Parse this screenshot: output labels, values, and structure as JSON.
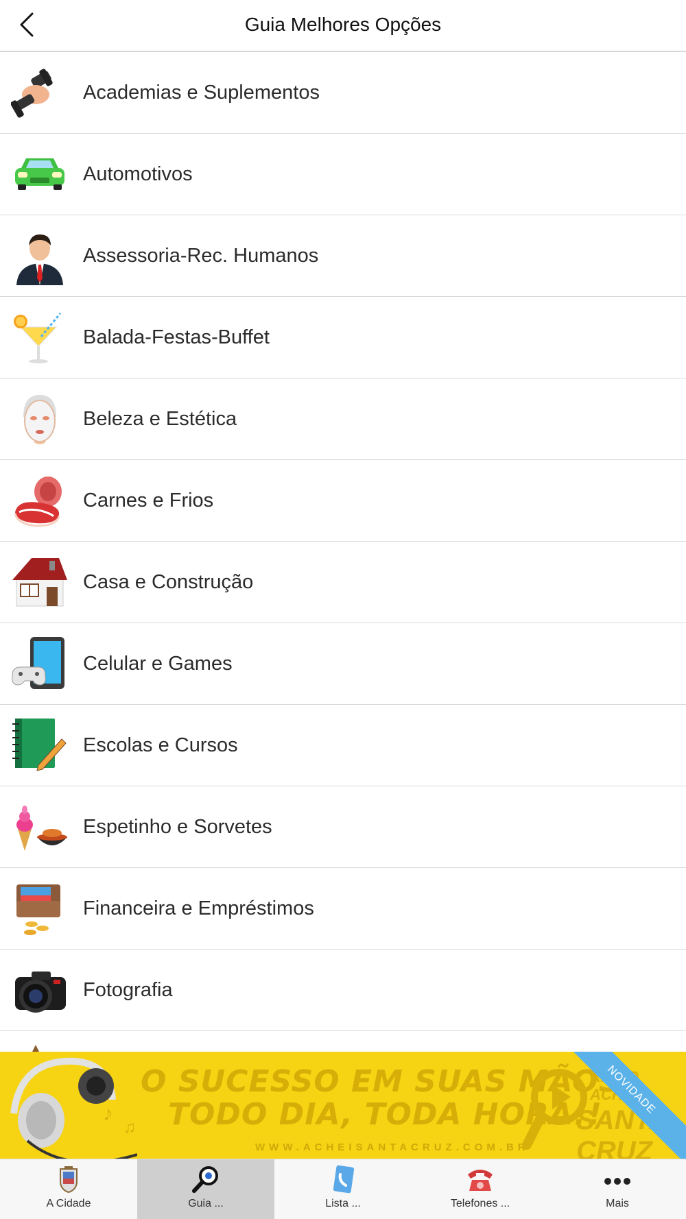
{
  "header": {
    "title": "Guia Melhores Opções"
  },
  "categories": [
    {
      "label": "Academias e Suplementos",
      "icon": "dumbbell-icon"
    },
    {
      "label": "Automotivos",
      "icon": "car-icon"
    },
    {
      "label": "Assessoria-Rec. Humanos",
      "icon": "businessman-icon"
    },
    {
      "label": "Balada-Festas-Buffet",
      "icon": "cocktail-icon"
    },
    {
      "label": "Beleza e Estética",
      "icon": "face-mask-icon"
    },
    {
      "label": "Carnes e Frios",
      "icon": "meat-icon"
    },
    {
      "label": "Casa e Construção",
      "icon": "house-icon"
    },
    {
      "label": "Celular e Games",
      "icon": "phone-gamepad-icon"
    },
    {
      "label": "Escolas e Cursos",
      "icon": "notebook-pencil-icon"
    },
    {
      "label": "Espetinho e Sorvetes",
      "icon": "icecream-grill-icon"
    },
    {
      "label": "Financeira e Empréstimos",
      "icon": "wallet-coins-icon"
    },
    {
      "label": "Fotografia",
      "icon": "camera-icon"
    }
  ],
  "banner": {
    "line1": "O SUCESSO EM SUAS MÃOS",
    "line2": "TODO DIA, TODA HORA!!",
    "url": "WWW.ACHEISANTACRUZ.COM.BR",
    "ribbon": "NOVIDADE",
    "radio_top": "RÁDIO ACHEI",
    "radio_bottom": "SANTA CRUZ"
  },
  "tabs": [
    {
      "label": "A Cidade",
      "icon": "city-crest-icon",
      "active": false
    },
    {
      "label": "Guia ...",
      "icon": "magnifier-icon",
      "active": true
    },
    {
      "label": "Lista ...",
      "icon": "phonebook-icon",
      "active": false
    },
    {
      "label": "Telefones ...",
      "icon": "telephone-icon",
      "active": false
    },
    {
      "label": "Mais",
      "icon": "more-dots-icon",
      "active": false
    }
  ],
  "colors": {
    "banner_bg": "#f6d313",
    "active_tab": "#cfcfcf",
    "divider": "#d8d8d8"
  }
}
